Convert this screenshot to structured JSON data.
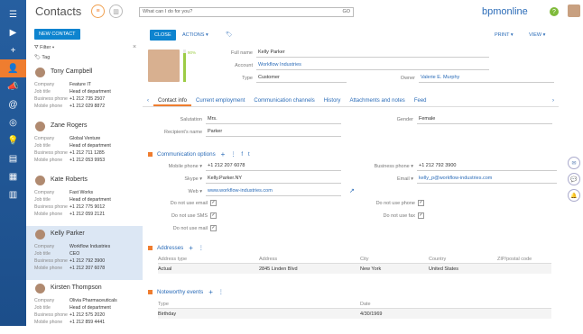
{
  "header": {
    "title": "Contacts",
    "search_placeholder": "What can I do for you?",
    "search_go": "GO",
    "brand": "bpmonline"
  },
  "left": {
    "new_contact": "NEW CONTACT",
    "filter": "Filter",
    "tag": "Tag",
    "labels": {
      "company": "Company",
      "job": "Job title",
      "bphone": "Business phone",
      "mphone": "Mobile phone"
    },
    "cards": [
      {
        "name": "Tony Campbell",
        "company": "Feature IT",
        "job": "Head of department",
        "bphone": "+1 212 735 2507",
        "mphone": "+1 212 029 8872"
      },
      {
        "name": "Zane Rogers",
        "company": "Global Venture",
        "job": "Head of department",
        "bphone": "+1 212 711 1285",
        "mphone": "+1 212 053 9953"
      },
      {
        "name": "Kate Roberts",
        "company": "Fast Works",
        "job": "Head of department",
        "bphone": "+1 212 775 9012",
        "mphone": "+1 212 059 2121"
      },
      {
        "name": "Kelly Parker",
        "company": "Workflow Industries",
        "job": "CEO",
        "bphone": "+1 212 792 3900",
        "mphone": "+1 212 207 6078"
      },
      {
        "name": "Kirsten Thompson",
        "company": "Olivia Pharmaceuticals",
        "job": "Head of department",
        "bphone": "+1 212 575 2020",
        "mphone": "+1 212 859 4441"
      }
    ]
  },
  "main": {
    "close": "CLOSE",
    "actions": "ACTIONS",
    "print": "PRINT",
    "view": "VIEW",
    "progress_label": "90%",
    "progress": 0.9,
    "full_name_label": "Full name",
    "full_name": "Kelly Parker",
    "account_label": "Account",
    "account": "Workflow Industries",
    "type_label": "Type",
    "type": "Customer",
    "owner_label": "Owner",
    "owner": "Valerie E. Murphy",
    "tabs": [
      "Contact info",
      "Current employment",
      "Communication channels",
      "History",
      "Attachments and notes",
      "Feed"
    ],
    "salutation_label": "Salutation",
    "salutation": "Mrs.",
    "recip_label": "Recipient's name",
    "recip": "Parker",
    "gender_label": "Gender",
    "gender": "Female",
    "comm_title": "Communication options",
    "mobile_label": "Mobile phone",
    "mobile": "+1 212 207 6078",
    "skype_label": "Skype",
    "skype": "Kelly.Parker.NY",
    "web_label": "Web",
    "web": "www.workflow-industries.com",
    "bphone_label": "Business phone",
    "bphone": "+1 212 792 3900",
    "email_label": "Email",
    "email": "kelly_p@workflow-industries.com",
    "dnu_email": "Do not use email",
    "dnu_sms": "Do not use SMS",
    "dnu_mail": "Do not use mail",
    "dnu_phone": "Do not use phone",
    "dnu_fax": "Do not use fax",
    "addr_title": "Addresses",
    "addr_headers": [
      "Address type",
      "Address",
      "City",
      "Country",
      "ZIP/postal code"
    ],
    "addr_row": [
      "Actual",
      "2845 Linden Blvd",
      "New York",
      "United States",
      ""
    ],
    "events_title": "Noteworthy events",
    "events_headers": [
      "Type",
      "Date"
    ],
    "events_row": [
      "Birthday",
      "4/30/1969"
    ]
  }
}
